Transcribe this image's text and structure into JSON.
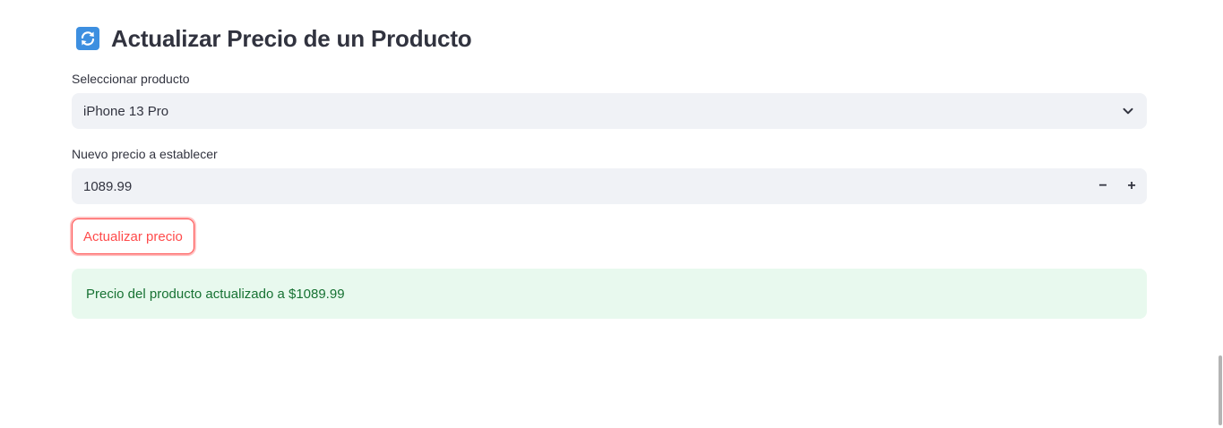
{
  "header": {
    "icon": "arrows-cycle-icon",
    "title": "Actualizar Precio de un Producto"
  },
  "product_select": {
    "label": "Seleccionar producto",
    "selected_value": "iPhone 13 Pro",
    "icon": "chevron-down-icon"
  },
  "price_input": {
    "label": "Nuevo precio a establecer",
    "value": "1089.99",
    "decrement_label": "−",
    "increment_label": "+"
  },
  "submit": {
    "label": "Actualizar precio"
  },
  "success_alert": {
    "message": "Precio del producto actualizado a $1089.99"
  },
  "colors": {
    "accent": "#ff4b4b",
    "input_bg": "#f0f2f6",
    "success_bg": "#e8f9ee",
    "success_text": "#177233"
  }
}
